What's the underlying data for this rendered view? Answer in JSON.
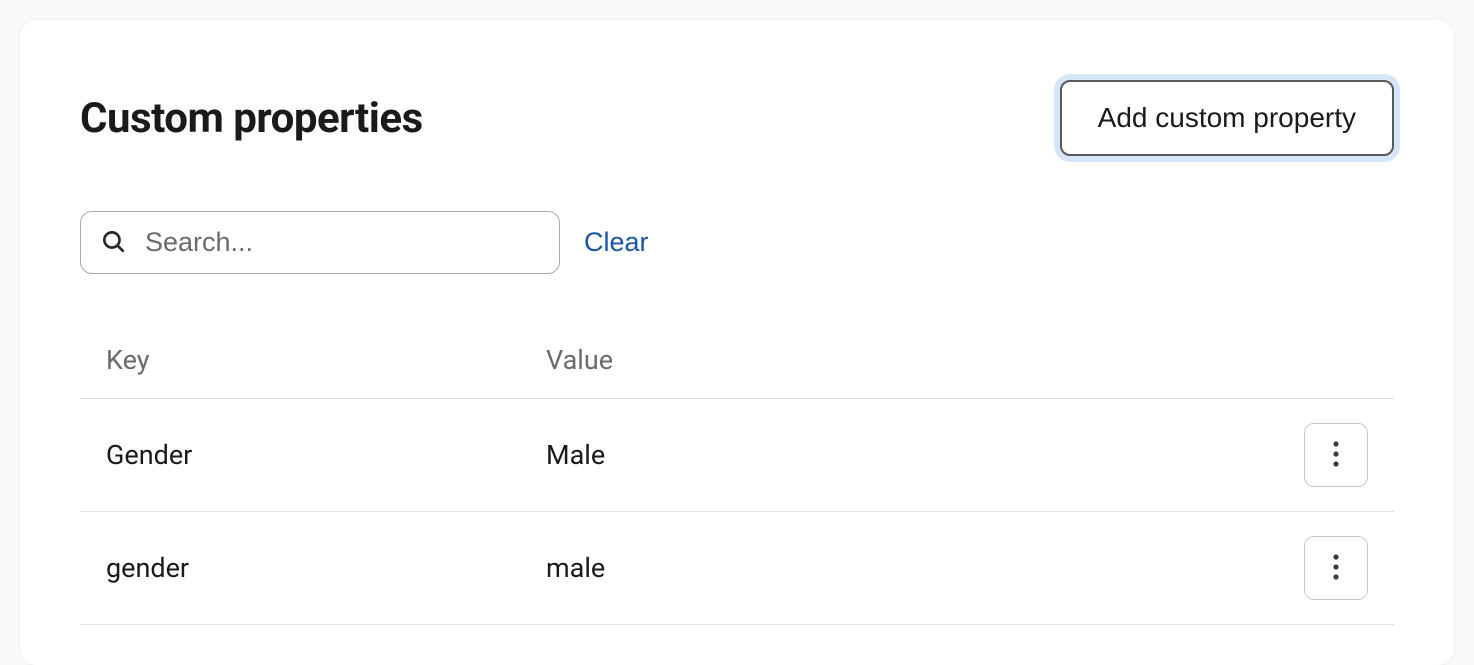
{
  "header": {
    "title": "Custom properties",
    "add_label": "Add custom property"
  },
  "filter": {
    "search_placeholder": "Search...",
    "search_value": "",
    "clear_label": "Clear"
  },
  "table": {
    "columns": {
      "key": "Key",
      "value": "Value"
    },
    "rows": [
      {
        "key": "Gender",
        "value": "Male"
      },
      {
        "key": "gender",
        "value": "male"
      }
    ]
  }
}
